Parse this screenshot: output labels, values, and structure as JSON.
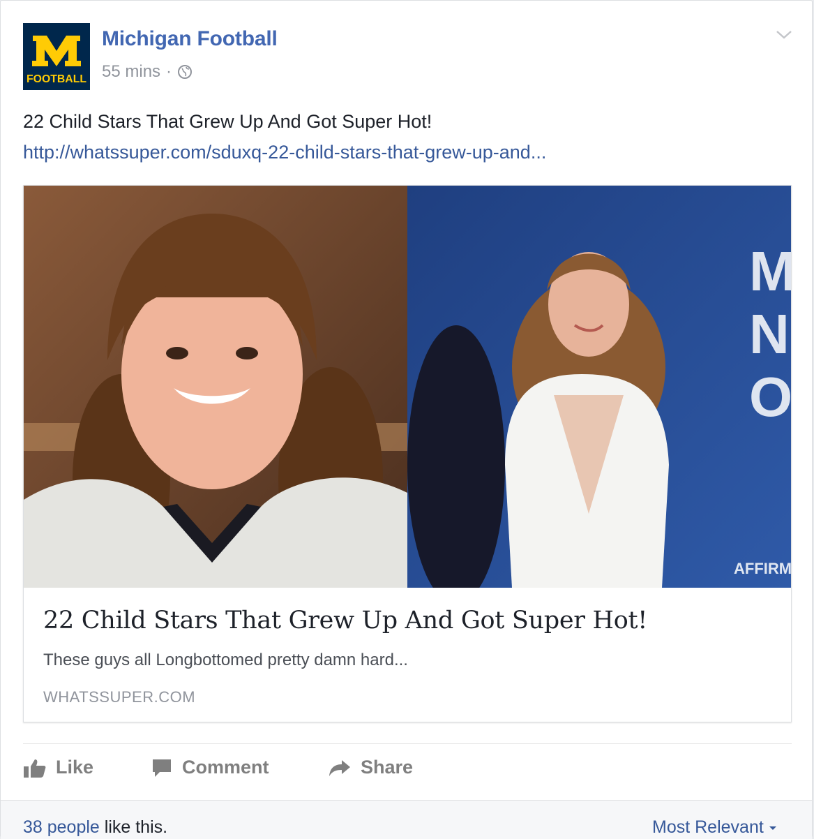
{
  "post": {
    "page_name": "Michigan Football",
    "time": "55 mins",
    "separator": "·",
    "privacy_icon": "globe-icon",
    "menu_icon": "chevron-down-icon",
    "message": "22 Child Stars That Grew Up And Got Super Hot!",
    "link": "http://whatssuper.com/sduxq-22-child-stars-that-grew-up-and..."
  },
  "logo": {
    "letter": "M",
    "word": "FOOTBALL",
    "bg_color": "#00274c",
    "accent_color": "#ffcb05"
  },
  "card": {
    "title": "22 Child Stars That Grew Up And Got Super Hot!",
    "description": "These guys all Longbottomed pretty damn hard...",
    "domain": "WHATSSUPER.COM",
    "backdrop_text_large": "MO\nNI\nO",
    "backdrop_text_small": "AFFIRM"
  },
  "actions": {
    "like": "Like",
    "comment": "Comment",
    "share": "Share"
  },
  "footer": {
    "likes_link": "38 people",
    "likes_rest": " like this.",
    "sort": "Most Relevant"
  },
  "colors": {
    "link": "#365899",
    "page_name": "#4267b2",
    "muted": "#90949c",
    "backdrop_blue": "#2a4d92"
  }
}
